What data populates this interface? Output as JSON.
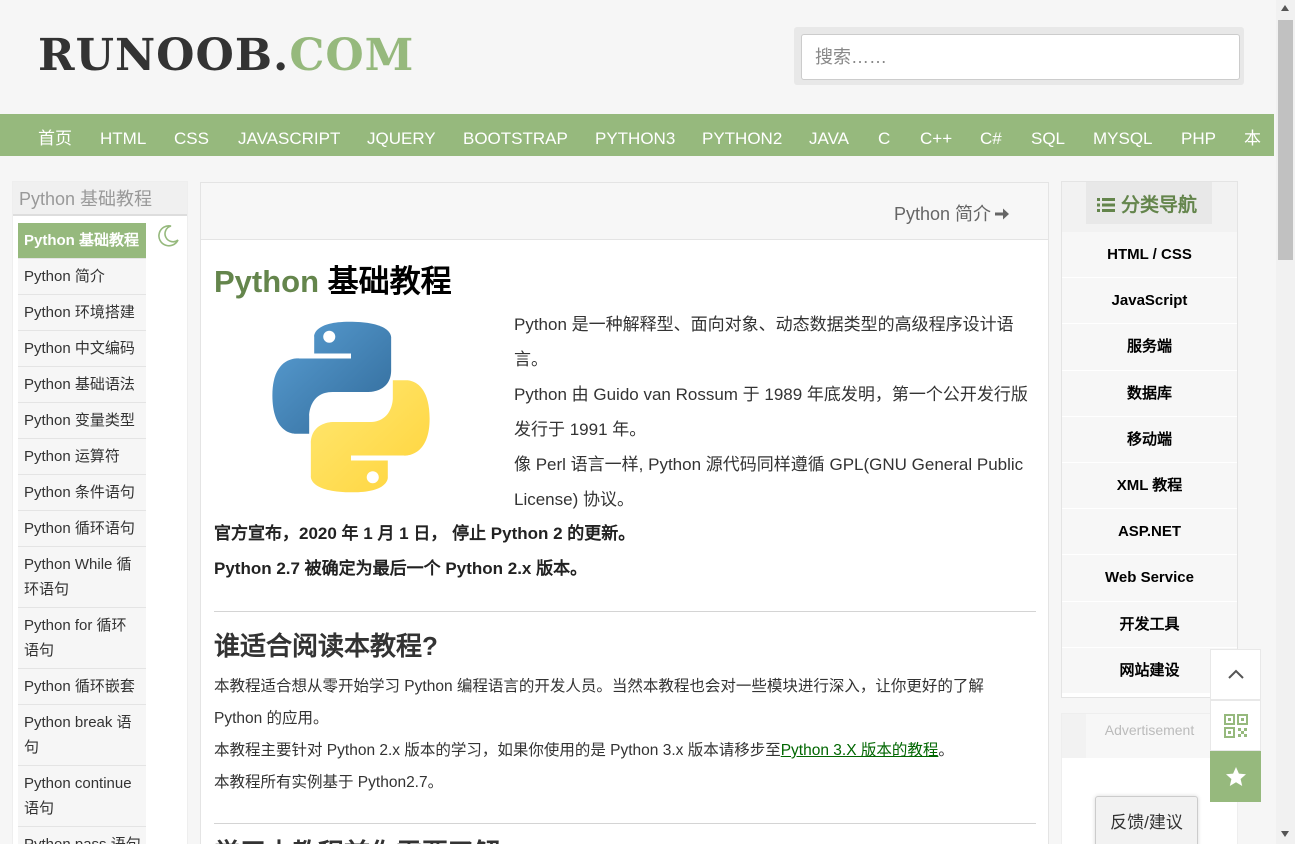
{
  "header": {
    "logo_part1": "RUNOOB.",
    "logo_part2": "COM",
    "search_placeholder": "搜索……"
  },
  "nav": {
    "items": [
      "首页",
      "HTML",
      "CSS",
      "JAVASCRIPT",
      "JQUERY",
      "BOOTSTRAP",
      "PYTHON3",
      "PYTHON2",
      "JAVA",
      "C",
      "C++",
      "C#",
      "SQL",
      "MYSQL",
      "PHP",
      "本"
    ]
  },
  "left_sidebar": {
    "title": "Python 基础教程",
    "items": [
      "Python 基础教程",
      "Python 简介",
      "Python 环境搭建",
      "Python 中文编码",
      "Python 基础语法",
      "Python 变量类型",
      "Python 运算符",
      "Python 条件语句",
      "Python 循环语句",
      "Python While 循环语句",
      "Python for 循环语句",
      "Python 循环嵌套",
      "Python break 语句",
      "Python continue 语句",
      "Python pass 语句"
    ]
  },
  "main": {
    "next_link": "Python 简介",
    "title_green": "Python",
    "title_rest": " 基础教程",
    "intro": [
      "Python 是一种解释型、面向对象、动态数据类型的高级程序设计语言。",
      "Python 由 Guido van Rossum 于 1989 年底发明，第一个公开发行版发行于 1991 年。",
      "像 Perl 语言一样, Python 源代码同样遵循 GPL(GNU General Public License) 协议。"
    ],
    "notice": [
      "官方宣布，2020 年 1 月 1 日， 停止 Python 2 的更新。",
      "Python 2.7 被确定为最后一个 Python 2.x 版本。"
    ],
    "who_heading": "谁适合阅读本教程?",
    "who_line1": "本教程适合想从零开始学习 Python 编程语言的开发人员。当然本教程也会对一些模块进行深入，让你更好的了解 Python 的应用。",
    "who_line2_pre": "本教程主要针对 Python 2.x 版本的学习，如果你使用的是 Python 3.x 版本请移步至",
    "who_line2_link": "Python 3.X 版本的教程",
    "who_line2_post": "。",
    "who_line3": "本教程所有实例基于 Python2.7。",
    "next_heading": "学习本教程前你需要了解"
  },
  "right_sidebar": {
    "title": "分类导航",
    "items": [
      "HTML / CSS",
      "JavaScript",
      "服务端",
      "数据库",
      "移动端",
      "XML 教程",
      "ASP.NET",
      "Web Service",
      "开发工具",
      "网站建设"
    ],
    "ad_label": "Advertisement"
  },
  "float": {
    "feedback": "反馈/建议",
    "up_icon": "chevron-up-icon",
    "qr_icon": "qrcode-icon",
    "star_icon": "star-icon"
  },
  "colors": {
    "brand_green": "#96b97d",
    "title_green": "#64854c",
    "link_green": "#006600"
  }
}
